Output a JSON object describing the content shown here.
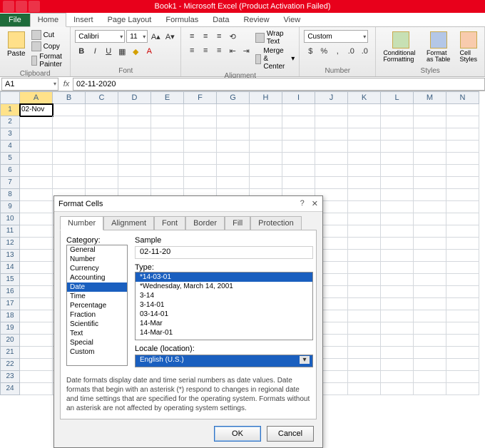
{
  "titlebar": {
    "title": "Book1 - Microsoft Excel (Product Activation Failed)"
  },
  "tabs": {
    "file": "File",
    "items": [
      "Home",
      "Insert",
      "Page Layout",
      "Formulas",
      "Data",
      "Review",
      "View"
    ],
    "active": "Home"
  },
  "ribbon": {
    "clipboard": {
      "label": "Clipboard",
      "paste": "Paste",
      "cut": "Cut",
      "copy": "Copy",
      "format_painter": "Format Painter"
    },
    "font": {
      "label": "Font",
      "face": "Calibri",
      "size": "11"
    },
    "alignment": {
      "label": "Alignment",
      "wrap": "Wrap Text",
      "merge": "Merge & Center"
    },
    "number": {
      "label": "Number",
      "format": "Custom"
    },
    "styles": {
      "label": "Styles",
      "cond": "Conditional Formatting",
      "table": "Format as Table",
      "cell": "Cell Styles"
    }
  },
  "formula": {
    "namebox": "A1",
    "fx": "fx",
    "value": "02-11-2020"
  },
  "columns": [
    "A",
    "B",
    "C",
    "D",
    "E",
    "F",
    "G",
    "H",
    "I",
    "J",
    "K",
    "L",
    "M",
    "N"
  ],
  "row_count": 24,
  "active_cell": {
    "row": 1,
    "col": "A",
    "display": "02-Nov"
  },
  "dialog": {
    "title": "Format Cells",
    "help": "?",
    "close": "✕",
    "tabs": [
      "Number",
      "Alignment",
      "Font",
      "Border",
      "Fill",
      "Protection"
    ],
    "active_tab": "Number",
    "category_label": "Category:",
    "categories": [
      "General",
      "Number",
      "Currency",
      "Accounting",
      "Date",
      "Time",
      "Percentage",
      "Fraction",
      "Scientific",
      "Text",
      "Special",
      "Custom"
    ],
    "category_selected": "Date",
    "sample_label": "Sample",
    "sample_value": "02-11-20",
    "type_label": "Type:",
    "types": [
      "*14-03-01",
      "*Wednesday, March 14, 2001",
      "3-14",
      "3-14-01",
      "03-14-01",
      "14-Mar",
      "14-Mar-01"
    ],
    "type_selected": "*14-03-01",
    "locale_label": "Locale (location):",
    "locale_value": "English (U.S.)",
    "description": "Date formats display date and time serial numbers as date values. Date formats that begin with an asterisk (*) respond to changes in regional date and time settings that are specified for the operating system. Formats without an asterisk are not affected by operating system settings.",
    "ok": "OK",
    "cancel": "Cancel"
  }
}
